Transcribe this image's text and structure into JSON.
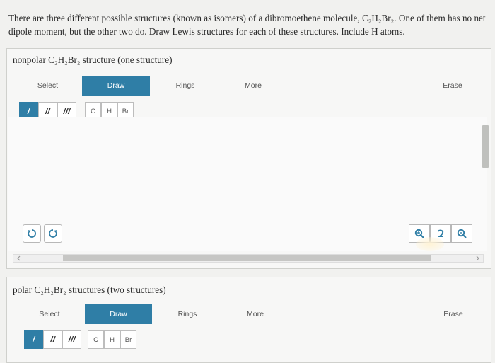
{
  "question": {
    "text": "There are three different possible structures (known as isomers) of a dibromoethene molecule, C₂H₂Br₂. One of them has no net dipole moment, but the other two do. Draw Lewis structures for each of these structures. Include H atoms."
  },
  "panel1": {
    "title": "nonpolar C₂H₂Br₂ structure (one structure)",
    "toolbar": {
      "select": "Select",
      "draw": "Draw",
      "rings": "Rings",
      "more": "More",
      "erase": "Erase"
    },
    "bonds": [
      "/",
      "//",
      "///"
    ],
    "atoms": [
      "C",
      "H",
      "Br"
    ]
  },
  "panel2": {
    "title": "polar C₂H₂Br₂ structures (two structures)",
    "toolbar": {
      "select": "Select",
      "draw": "Draw",
      "rings": "Rings",
      "more": "More",
      "erase": "Erase"
    },
    "bonds": [
      "/",
      "//",
      "///"
    ],
    "atoms": [
      "C",
      "H",
      "Br"
    ]
  },
  "colors": {
    "accent": "#2f7ea6",
    "background": "#f1f1ef"
  },
  "icons": [
    "undo-icon",
    "redo-icon",
    "zoom-in-icon",
    "reset-zoom-icon",
    "zoom-out-icon",
    "chevron-left-icon",
    "chevron-right-icon"
  ]
}
